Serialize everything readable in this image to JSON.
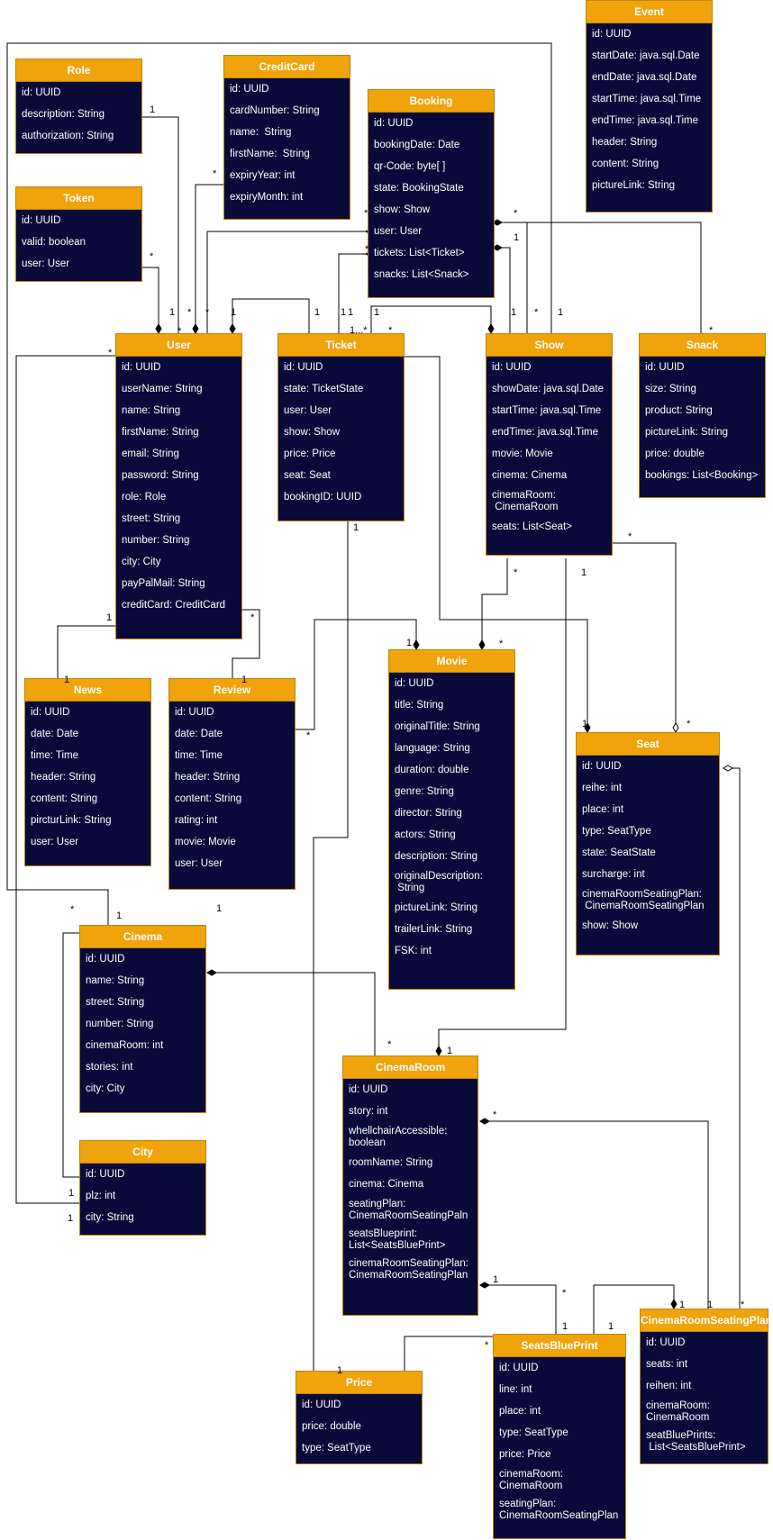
{
  "classes": {
    "event": {
      "name": "Event",
      "attrs": [
        "id: UUID",
        "startDate: java.sql.Date",
        "endDate: java.sql.Date",
        "startTime: java.sql.Time",
        "endTime: java.sql.Time",
        "header: String",
        "content: String",
        "pictureLink: String"
      ]
    },
    "role": {
      "name": "Role",
      "attrs": [
        "id: UUID",
        "description: String",
        "authorization: String"
      ]
    },
    "creditcard": {
      "name": "CreditCard",
      "attrs": [
        "id: UUID",
        "cardNumber: String",
        "name:  String",
        "firstName:  String",
        "expiryYear: int",
        "expiryMonth: int"
      ]
    },
    "booking": {
      "name": "Booking",
      "attrs": [
        "id: UUID",
        "bookingDate: Date",
        "qr-Code: byte[ ]",
        "state: BookingState",
        "show: Show",
        "user: User",
        "tickets: List<Ticket>",
        "snacks: List<Snack>"
      ]
    },
    "token": {
      "name": "Token",
      "attrs": [
        "id: UUID",
        "valid: boolean",
        "user: User"
      ]
    },
    "user": {
      "name": "User",
      "attrs": [
        "id: UUID",
        "userName: String",
        "name: String",
        "firstName: String",
        "email: String",
        "password: String",
        "role: Role",
        "street: String",
        "number: String",
        "city: City",
        "payPalMail: String",
        "creditCard: CreditCard"
      ]
    },
    "ticket": {
      "name": "Ticket",
      "attrs": [
        "id: UUID",
        "state: TicketState",
        "user: User",
        "show: Show",
        "price: Price",
        "seat: Seat",
        "bookingID: UUID"
      ]
    },
    "show": {
      "name": "Show",
      "attrs": [
        "id: UUID",
        "showDate: java.sql.Date",
        "startTime: java.sql.Time",
        "endTime: java.sql.Time",
        "movie: Movie",
        "cinema: Cinema",
        "cinemaRoom:\n CinemaRoom",
        "seats: List<Seat>"
      ]
    },
    "snack": {
      "name": "Snack",
      "attrs": [
        "id: UUID",
        "size: String",
        "product: String",
        "pictureLink: String",
        "price: double",
        "bookings: List<Booking>"
      ]
    },
    "news": {
      "name": "News",
      "attrs": [
        "id: UUID",
        "date: Date",
        "time: Time",
        "header: String",
        "content: String",
        "pircturLink: String",
        "user: User"
      ]
    },
    "review": {
      "name": "Review",
      "attrs": [
        "id: UUID",
        "date: Date",
        "time: Time",
        "header: String",
        "content: String",
        "rating: int",
        "movie: Movie",
        "user: User"
      ]
    },
    "movie": {
      "name": "Movie",
      "attrs": [
        "id: UUID",
        "title: String",
        "originalTitle: String",
        "language: String",
        "duration: double",
        "genre: String",
        "director: String",
        "actors: String",
        "description: String",
        "originalDescription:\n String",
        "pictureLink: String",
        "trailerLink: String",
        "FSK: int"
      ]
    },
    "seat": {
      "name": "Seat",
      "attrs": [
        "id: UUID",
        "reihe: int",
        "place: int",
        "type: SeatType",
        "state: SeatState",
        "surcharge: int",
        "cinemaRoomSeatingPlan:\n CinemaRoomSeatingPlan",
        "show: Show"
      ]
    },
    "cinema": {
      "name": "Cinema",
      "attrs": [
        "id: UUID",
        "name: String",
        "street: String",
        "number: String",
        "cinemaRoom: int",
        "stories: int",
        "city: City"
      ]
    },
    "city": {
      "name": "City",
      "attrs": [
        "id: UUID",
        "plz: int",
        "city: String"
      ]
    },
    "cinemaroom": {
      "name": "CinemaRoom",
      "attrs": [
        "id: UUID",
        "story: int",
        "whellchairAccessible:\nboolean",
        "roomName: String",
        "cinema: Cinema",
        "seatingPlan:\nCinemaRoomSeatingPaln",
        "seatsBlueprint:\nList<SeatsBluePrint>",
        "cinemaRoomSeatingPlan:\nCinemaRoomSeatingPlan"
      ]
    },
    "price": {
      "name": "Price",
      "attrs": [
        "id: UUID",
        "price: double",
        "type: SeatType"
      ]
    },
    "seatsblueprint": {
      "name": "SeatsBluePrint",
      "attrs": [
        "id: UUID",
        "line: int",
        "place: int",
        "type: SeatType",
        "price: Price",
        "cinemaRoom:\nCinemaRoom",
        "seatingPlan:\nCinemaRoomSeatingPlan"
      ]
    },
    "seatingplan": {
      "name": "CinemaRoomSeatingPlan",
      "attrs": [
        "id: UUID",
        "seats: int",
        "reihen: int",
        "cinemaRoom:\nCinemaRoom",
        "seatBluePrints:\n List<SeatsBluePrint>"
      ]
    }
  },
  "multiplicities": [
    "1",
    "*",
    "*",
    "1",
    "*",
    "*",
    "1",
    "*",
    "*",
    "*",
    "1",
    "1",
    "1",
    "1",
    "*",
    "1...*",
    "*",
    "1",
    "1",
    "*",
    "1",
    "*",
    "*",
    "1",
    "1",
    "*",
    "1",
    "1",
    "*",
    "*",
    "1",
    "*",
    "1",
    "*",
    "*",
    "*",
    "1",
    "1",
    "1",
    "*",
    "1",
    "*",
    "1",
    "1",
    "1",
    "1",
    "1",
    "*",
    "*",
    "1",
    "1",
    "1",
    "*"
  ]
}
